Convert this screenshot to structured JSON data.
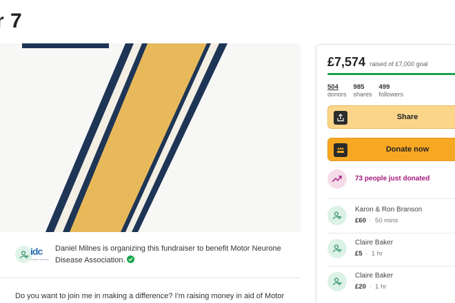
{
  "page": {
    "title": "r 7"
  },
  "organizer": {
    "logo_text": "idc",
    "logo_subtext": "motor neurone",
    "text": "Daniel Milnes is organizing this fundraiser to benefit Motor Neurone Disease Association."
  },
  "story": {
    "text": "Do you want to join me in making a difference? I'm raising money in aid of Motor"
  },
  "donation": {
    "raised": "£7,574",
    "goal_text": "raised of £7,000 goal",
    "progress": 1.0,
    "stats": [
      {
        "value": "504",
        "label": "donors"
      },
      {
        "value": "985",
        "label": "shares"
      },
      {
        "value": "499",
        "label": "followers"
      }
    ],
    "share_label": "Share",
    "donate_label": "Donate now",
    "recent_text": "73 people just donated",
    "donors": [
      {
        "name": "Karon & Ron Branson",
        "amount": "£60",
        "time": "50 mins"
      },
      {
        "name": "Claire Baker",
        "amount": "£5",
        "time": "1 hr"
      },
      {
        "name": "Claire Baker",
        "amount": "£20",
        "time": "1 hr"
      }
    ]
  },
  "colors": {
    "progress": "#16a34a",
    "share_button": "#fbd68a",
    "donate_button": "#f7a823",
    "recent_text": "#a3177a",
    "hero_stripe": "#e8b95b",
    "hero_navy": "#1e3556"
  },
  "icons": {
    "org_avatar": "user-heart-icon",
    "verified": "check-badge-icon",
    "share": "share-upload-icon",
    "donate": "gofundme-icon",
    "recent": "trending-up-icon",
    "donor_avatar": "user-heart-icon"
  }
}
